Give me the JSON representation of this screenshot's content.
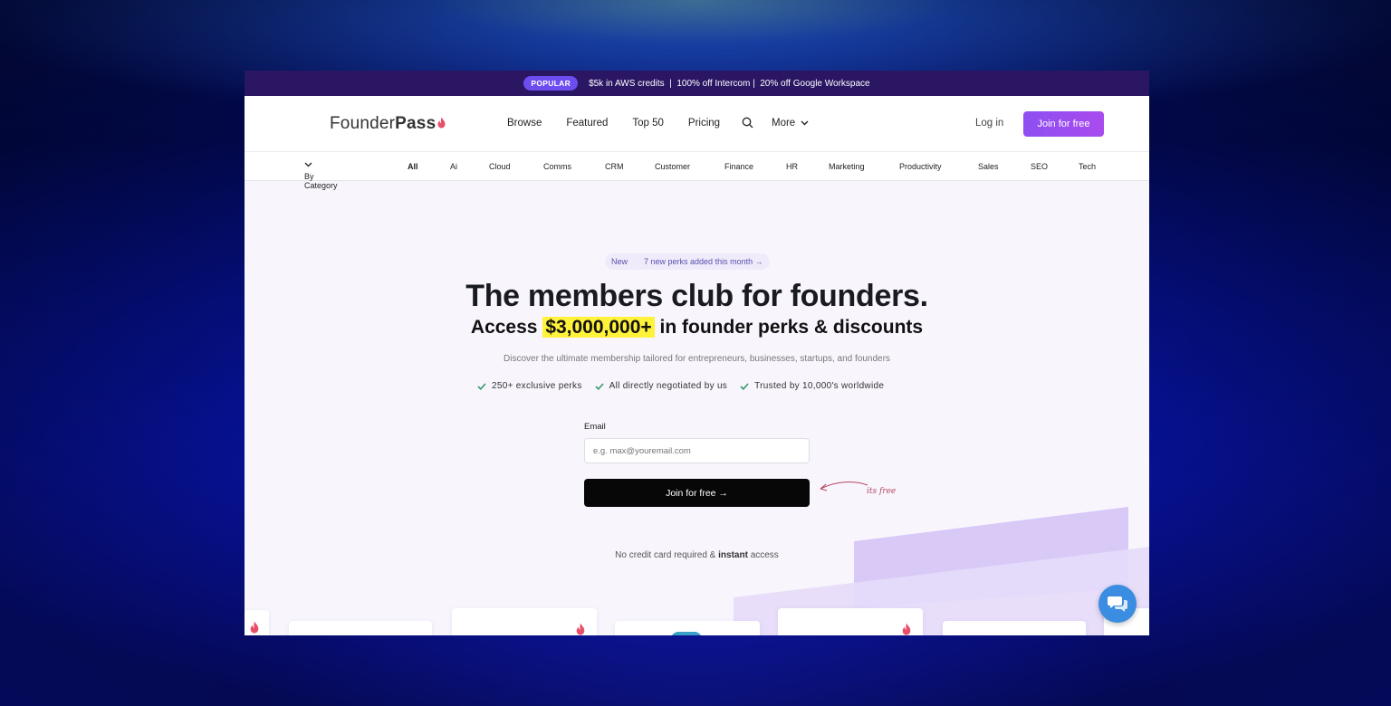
{
  "promo": {
    "badge": "POPULAR",
    "text": "$5k in AWS credits  |  100% off Intercom |  20% off Google Workspace"
  },
  "nav": {
    "logo_regular": "Founder",
    "logo_bold": "Pass",
    "links": [
      "Browse",
      "Featured",
      "Top 50",
      "Pricing"
    ],
    "more": "More",
    "login": "Log in",
    "join": "Join for free"
  },
  "categories": {
    "by_category": "By Category",
    "items": [
      "All",
      "Ai",
      "Cloud",
      "Comms",
      "CRM",
      "Customer",
      "Finance",
      "HR",
      "Marketing",
      "Productivity",
      "Sales",
      "SEO",
      "Tech"
    ]
  },
  "hero": {
    "pill_new": "New",
    "pill_text": "7 new perks added this month →",
    "title": "The members club for founders.",
    "subtitle_pre": "Access",
    "subtitle_highlight": "$3,000,000+",
    "subtitle_post": "in founder perks & discounts",
    "description": "Discover the ultimate membership tailored for entrepreneurs, businesses, startups, and founders",
    "checks": [
      "250+ exclusive perks",
      "All directly negotiated by us",
      "Trusted by 10,000's worldwide"
    ],
    "email_label": "Email",
    "email_placeholder": "e.g. max@youremail.com",
    "join_button": "Join for free →",
    "note": "its free",
    "nocc_pre": "No credit card required &",
    "nocc_bold": "instant",
    "nocc_post": "access"
  },
  "colors": {
    "accent": "#9b4df0",
    "promo_bg": "#2a1663",
    "highlight": "#fff23b",
    "check": "#3a9a6a",
    "flame": "#e8506a",
    "chat": "#3a8de0"
  }
}
